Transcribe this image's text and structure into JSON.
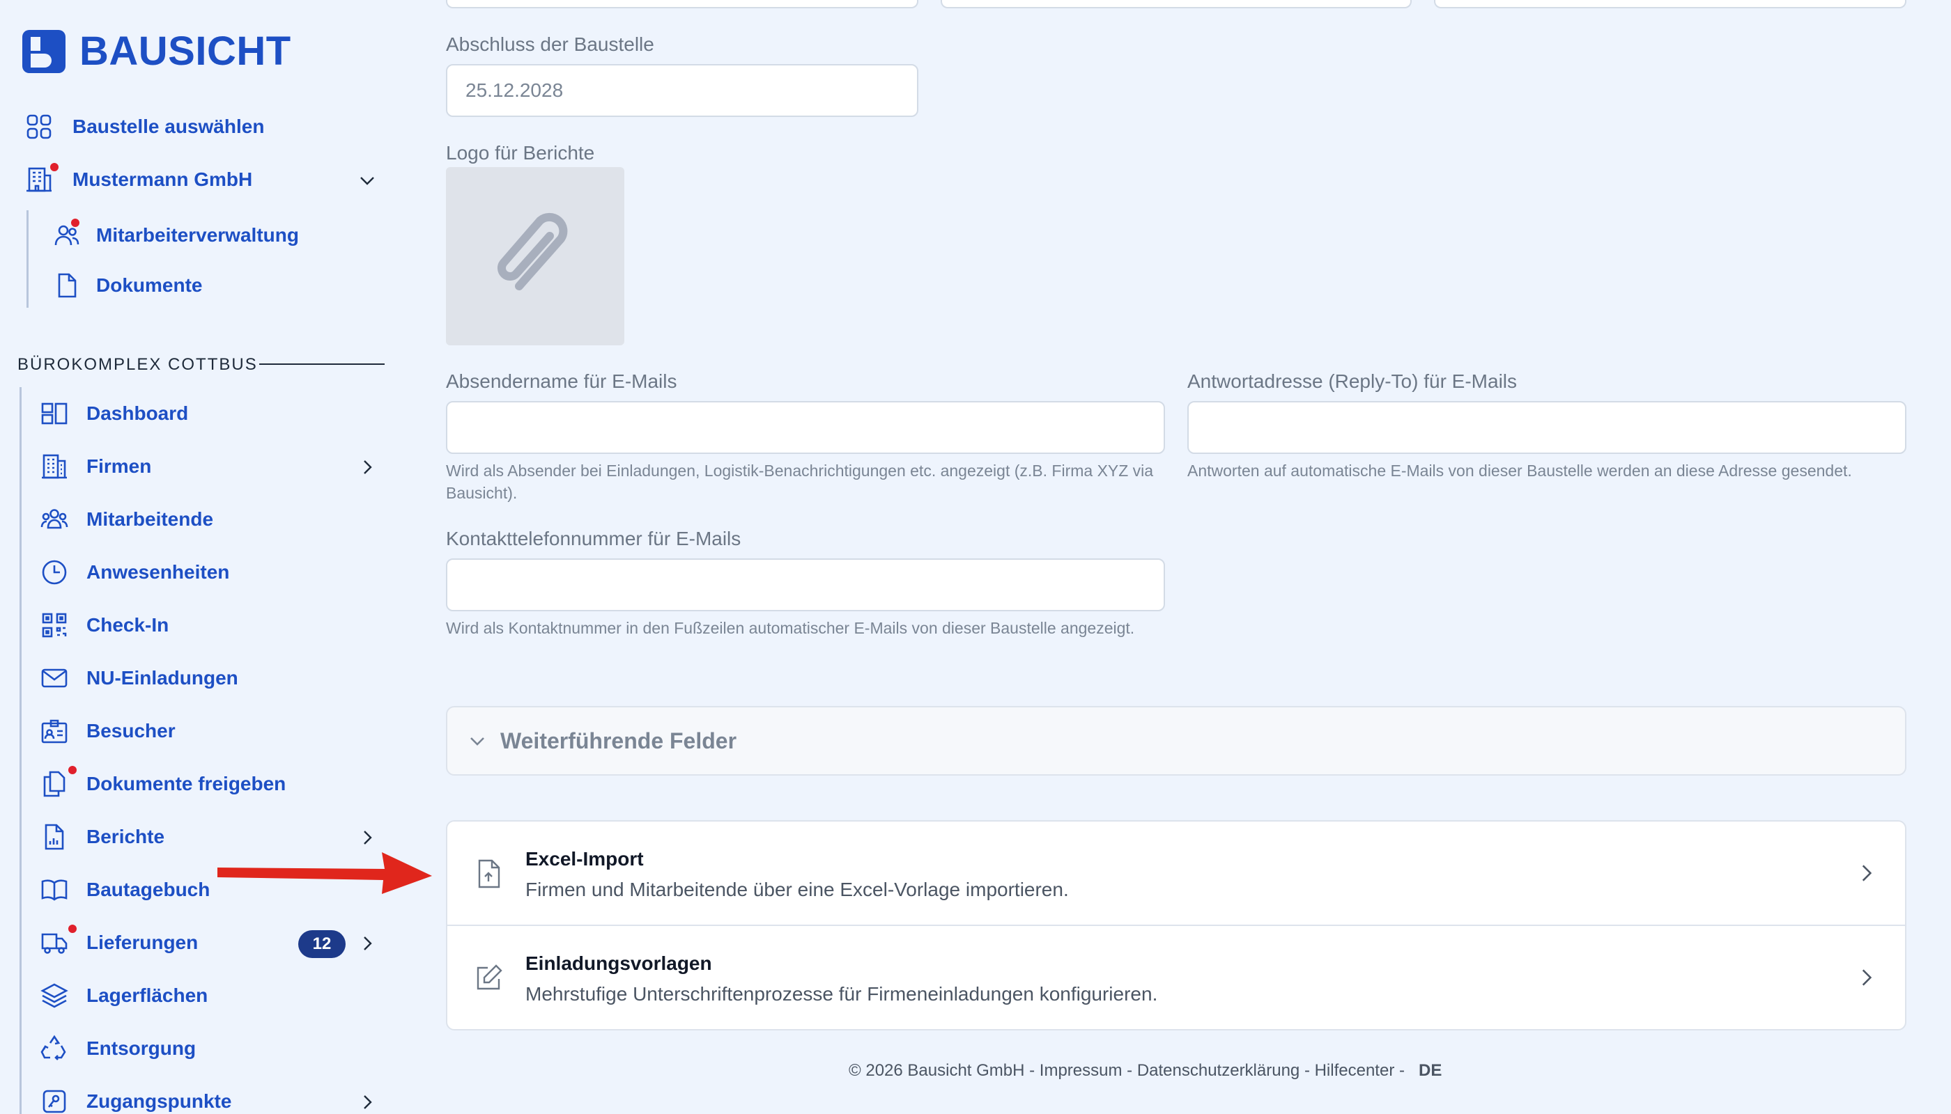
{
  "brand": {
    "name": "BAUSICHT",
    "color": "#1d4fc4"
  },
  "sidebar": {
    "top_items": [
      {
        "label": "Baustelle auswählen",
        "icon": "grid-icon"
      },
      {
        "label": "Mustermann GmbH",
        "icon": "building-icon"
      },
      {
        "label": "Mitarbeiterverwaltung",
        "icon": "users-icon"
      },
      {
        "label": "Dokumente",
        "icon": "document-icon"
      }
    ],
    "section_title": "BÜROKOMPLEX COTTBUS",
    "items": [
      {
        "label": "Dashboard",
        "icon": "dashboard-icon"
      },
      {
        "label": "Firmen",
        "icon": "office-building-icon"
      },
      {
        "label": "Mitarbeitende",
        "icon": "team-icon"
      },
      {
        "label": "Anwesenheiten",
        "icon": "clock-icon"
      },
      {
        "label": "Check-In",
        "icon": "qr-code-icon"
      },
      {
        "label": "NU-Einladungen",
        "icon": "envelope-icon"
      },
      {
        "label": "Besucher",
        "icon": "id-badge-icon"
      },
      {
        "label": "Dokumente freigeben",
        "icon": "documents-icon"
      },
      {
        "label": "Berichte",
        "icon": "report-icon"
      },
      {
        "label": "Bautagebuch",
        "icon": "book-icon"
      },
      {
        "label": "Lieferungen",
        "icon": "truck-icon"
      },
      {
        "label": "Lagerflächen",
        "icon": "layers-icon"
      },
      {
        "label": "Entsorgung",
        "icon": "recycle-icon"
      },
      {
        "label": "Zugangspunkte",
        "icon": "access-icon"
      }
    ],
    "deliveries_badge": "12"
  },
  "form": {
    "completion_label": "Abschluss der Baustelle",
    "completion_value": "25.12.2028",
    "logo_label": "Logo für Berichte",
    "sender_name_label": "Absendername für E-Mails",
    "sender_name_value": "",
    "sender_name_help": "Wird als Absender bei Einladungen, Logistik-Benachrichtigungen etc. angezeigt (z.B. Firma XYZ via Bausicht).",
    "reply_to_label": "Antwortadresse (Reply-To) für E-Mails",
    "reply_to_value": "",
    "reply_to_help": "Antworten auf automatische E-Mails von dieser Baustelle werden an diese Adresse gesendet.",
    "phone_label": "Kontakttelefonnummer für E-Mails",
    "phone_value": "",
    "phone_help": "Wird als Kontaktnummer in den Fußzeilen automatischer E-Mails von dieser Baustelle angezeigt."
  },
  "accordion": {
    "label": "Weiterführende Felder"
  },
  "cards": [
    {
      "title": "Excel-Import",
      "description": "Firmen und Mitarbeitende über eine Excel-Vorlage importieren.",
      "icon": "file-upload-icon"
    },
    {
      "title": "Einladungsvorlagen",
      "description": "Mehrstufige Unterschriftenprozesse für Firmeneinladungen konfigurieren.",
      "icon": "edit-icon"
    }
  ],
  "footer": {
    "text": "© 2026 Bausicht GmbH - Impressum - Datenschutzerklärung - Hilfecenter -",
    "language": "DE"
  },
  "colors": {
    "accent": "#1d4fc4",
    "notification": "#e0202c",
    "badge": "#1d3a8a",
    "arrow": "#e0261c"
  }
}
